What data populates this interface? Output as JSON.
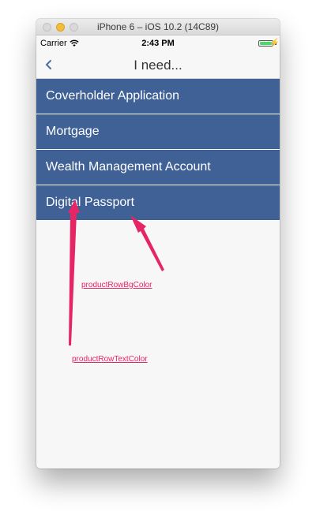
{
  "window": {
    "title": "iPhone 6 – iOS 10.2 (14C89)"
  },
  "status_bar": {
    "carrier": "Carrier",
    "time": "2:43 PM",
    "battery_level": 1.0
  },
  "nav": {
    "title": "I need...",
    "back_icon": "chevron-left-icon"
  },
  "products": [
    {
      "label": "Coverholder Application"
    },
    {
      "label": "Mortgage"
    },
    {
      "label": "Wealth Management Account"
    },
    {
      "label": "Digital Passport"
    }
  ],
  "annotations": {
    "bg_color_label": "productRowBgColor",
    "text_color_label": "productRowTextColor"
  },
  "colors": {
    "product_row_bg": "#3f6196",
    "product_row_text": "#ffffff",
    "annotation": "#e62565",
    "nav_tint": "#4a6fa5"
  }
}
